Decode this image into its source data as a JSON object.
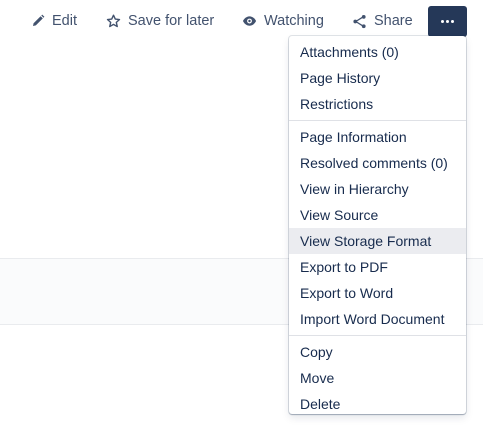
{
  "toolbar": {
    "edit_label": "Edit",
    "save_label": "Save for later",
    "watch_label": "Watching",
    "share_label": "Share",
    "more_icon": "ellipsis-icon"
  },
  "menu": {
    "sections": [
      [
        "Attachments (0)",
        "Page History",
        "Restrictions"
      ],
      [
        "Page Information",
        "Resolved comments (0)",
        "View in Hierarchy",
        "View Source",
        "View Storage Format",
        "Export to PDF",
        "Export to Word",
        "Import Word Document"
      ],
      [
        "Copy",
        "Move",
        "Delete"
      ]
    ],
    "highlighted_item": "View Storage Format"
  },
  "colors": {
    "toolbar_text": "#42526e",
    "more_button_bg": "#253858",
    "menu_text": "#172b4d",
    "highlight_bg": "#ebecf0"
  }
}
